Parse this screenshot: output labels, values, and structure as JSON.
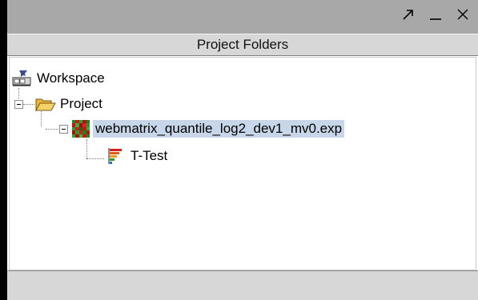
{
  "panel": {
    "title": "Project Folders"
  },
  "window_controls": {
    "icons": [
      "maximize-arrow-icon",
      "minimize-icon",
      "close-icon"
    ]
  },
  "tree": {
    "workspace": {
      "label": "Workspace",
      "icon": "workspace-icon"
    },
    "project": {
      "label": "Project",
      "icon": "folder-open-icon",
      "expanded": true
    },
    "experiment": {
      "label": "webmatrix_quantile_log2_dev1_mv0.exp",
      "icon": "heatmap-icon",
      "selected": true,
      "expanded": true
    },
    "analysis": {
      "label": "T-Test",
      "icon": "ttest-icon"
    }
  },
  "colors": {
    "selection": "#c8d6ea",
    "chrome": "#d7d7d7",
    "title_bar": "#a8a8a8"
  }
}
